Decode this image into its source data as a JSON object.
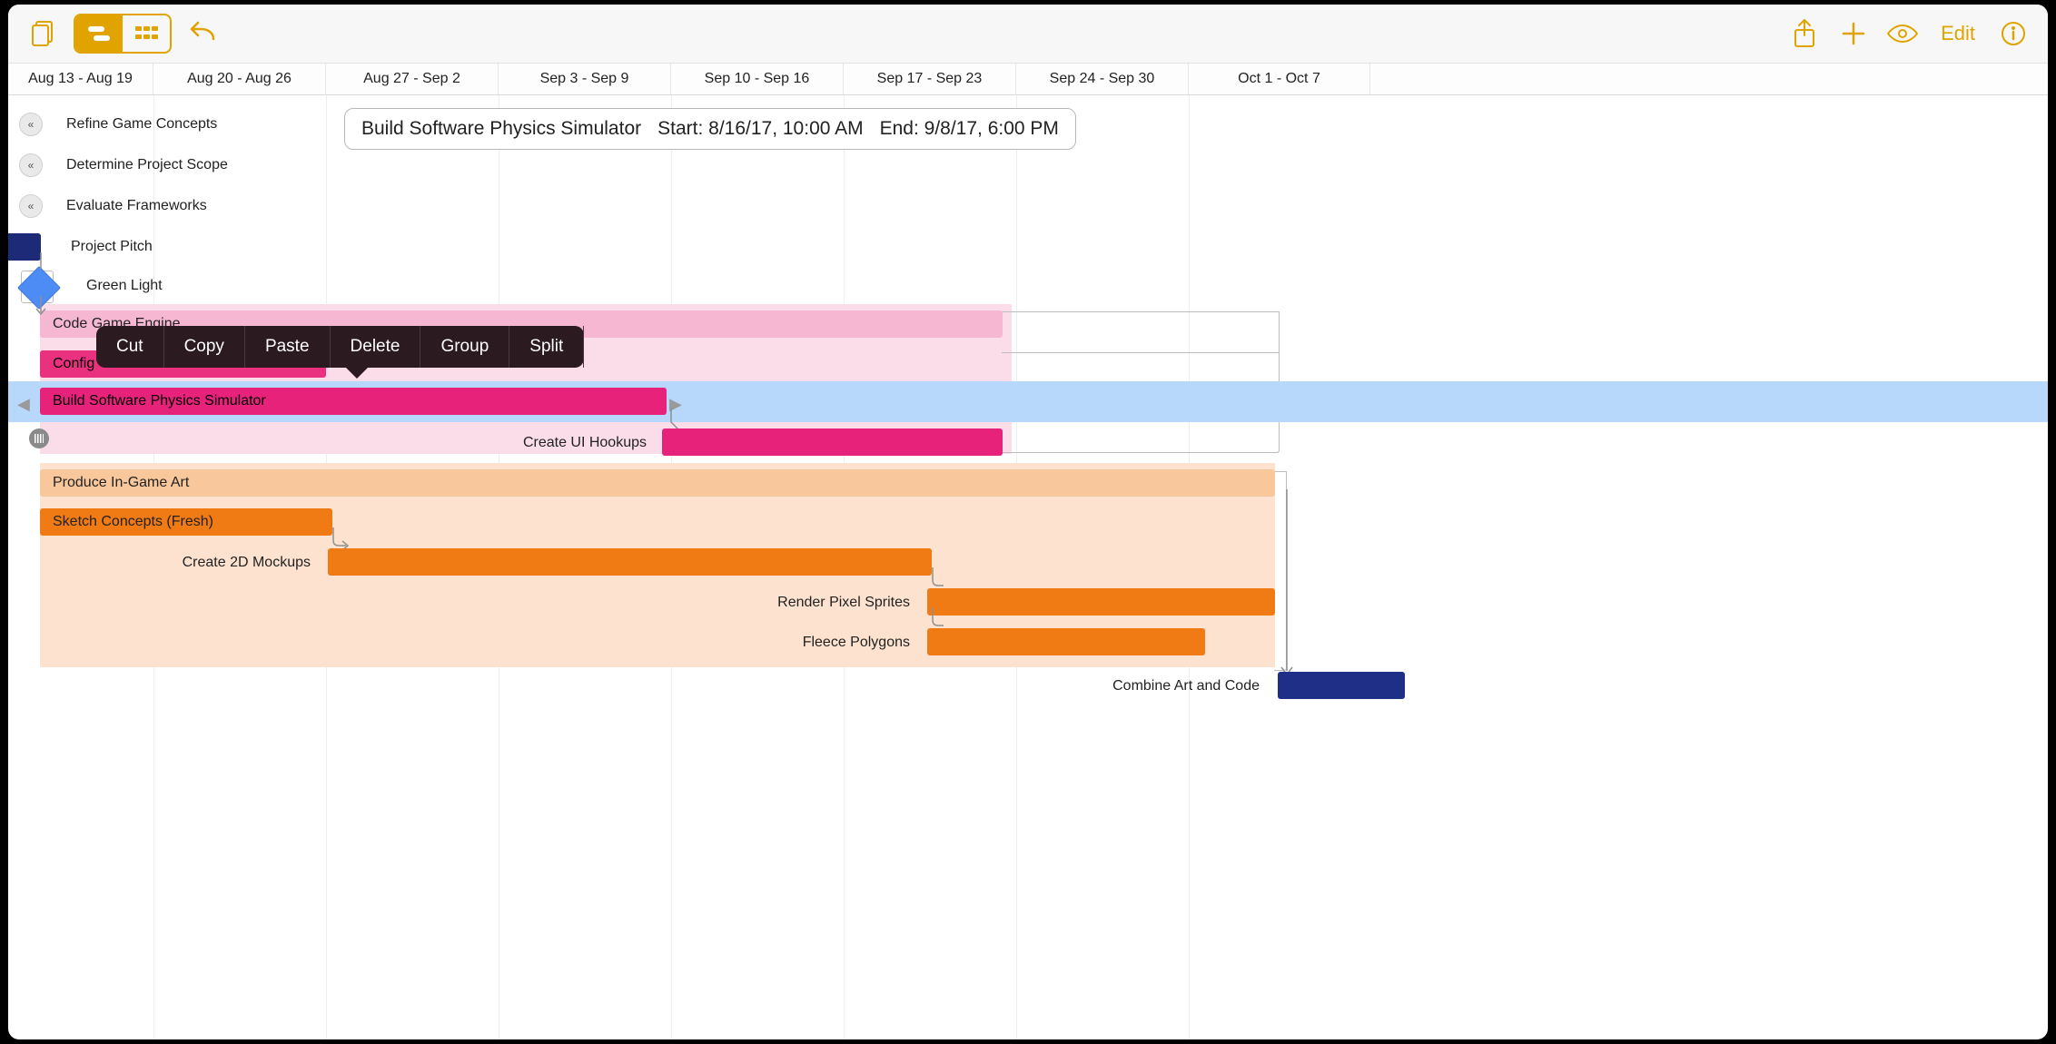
{
  "toolbar": {
    "edit_label": "Edit"
  },
  "weeks": [
    "Aug 13 - Aug 19",
    "Aug 20 - Aug 26",
    "Aug 27 - Sep 2",
    "Sep 3 - Sep 9",
    "Sep 10 - Sep 16",
    "Sep 17 - Sep 23",
    "Sep 24 - Sep 30",
    "Oct 1 - Oct 7"
  ],
  "info": {
    "title": "Build Software Physics Simulator",
    "start_label": "Start: 8/16/17, 10:00 AM",
    "end_label": "End: 9/8/17, 6:00 PM"
  },
  "ctxmenu": {
    "cut": "Cut",
    "copy": "Copy",
    "paste": "Paste",
    "delete": "Delete",
    "group": "Group",
    "split": "Split"
  },
  "tasks": {
    "refine": "Refine Game Concepts",
    "scope": "Determine Project Scope",
    "frameworks": "Evaluate Frameworks",
    "pitch": "Project Pitch",
    "greenlight": "Green Light",
    "engine": "Code Game Engine",
    "config": "Config",
    "simulator": "Build Software Physics Simulator",
    "hookups": "Create UI Hookups",
    "art_group": "Produce In-Game Art",
    "sketch": "Sketch Concepts (Fresh)",
    "mockups": "Create 2D Mockups",
    "sprites": "Render Pixel Sprites",
    "polygons": "Fleece Polygons",
    "combine": "Combine Art and Code"
  },
  "colors": {
    "accent": "#e0a300",
    "pink_group": "#f6b7d2",
    "pink_light": "#fbdce9",
    "magenta": "#e9317f",
    "magenta2": "#e6227b",
    "orange_group": "#fbd0ab",
    "orange": "#f07a14",
    "navy": "#1d2a78",
    "navy2": "#1f2e87",
    "milestone": "#4d8cf5",
    "highlight": "#b7d7fb"
  }
}
